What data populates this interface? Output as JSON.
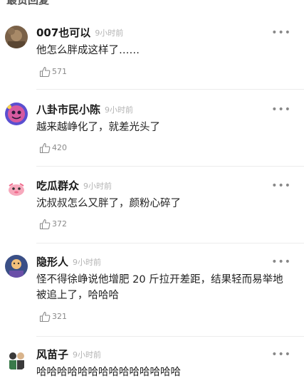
{
  "section_title": "最赞回复",
  "comments": [
    {
      "username": "007也可以",
      "time": "9小时前",
      "text": "他怎么胖成这样了……",
      "likes": "571",
      "avatar_colors": [
        "#6b5640",
        "#a88a68"
      ]
    },
    {
      "username": "八卦市民小陈",
      "time": "9小时前",
      "text": "越来越峥化了，就差光头了",
      "likes": "420",
      "avatar_colors": [
        "#d65aa0",
        "#5a4fd0"
      ]
    },
    {
      "username": "吃瓜群众",
      "time": "9小时前",
      "text": "沈叔叔怎么又胖了，颜粉心碎了",
      "likes": "372",
      "avatar_colors": [
        "#ffffff",
        "#f06b8c"
      ]
    },
    {
      "username": "隐形人",
      "time": "9小时前",
      "text": "怪不得徐峥说他增肥 20 斤拉开差距，结果轻而易举地被追上了，哈哈哈",
      "likes": "321",
      "avatar_colors": [
        "#3a4f86",
        "#f2c07a"
      ]
    },
    {
      "username": "风苗子",
      "time": "9小时前",
      "text": "哈哈哈哈哈哈哈哈哈哈哈哈哈哈",
      "likes": "",
      "avatar_colors": [
        "#ffffff",
        "#3a3a3a"
      ]
    }
  ],
  "more_label": "•••"
}
